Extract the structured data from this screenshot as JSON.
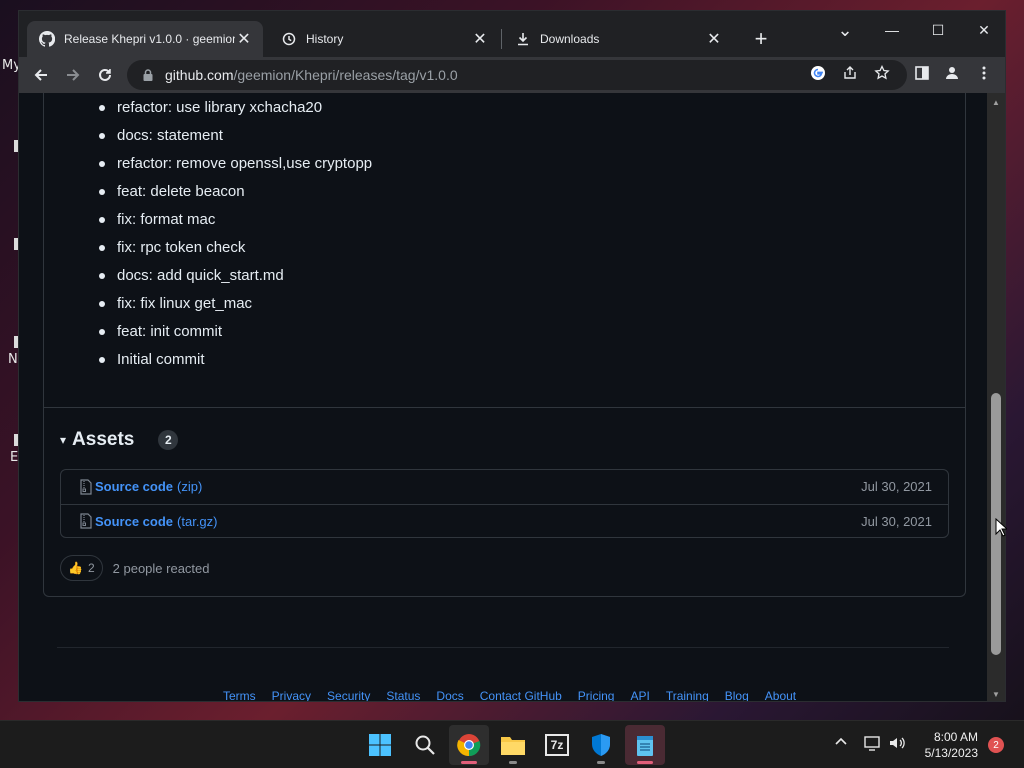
{
  "desktop": {
    "fragments": [
      "My",
      "N",
      "E"
    ]
  },
  "browser": {
    "tabs": [
      {
        "title": "Release Khepri v1.0.0 · geemion/",
        "icon": "github-icon",
        "active": true
      },
      {
        "title": "History",
        "icon": "history-icon",
        "active": false
      },
      {
        "title": "Downloads",
        "icon": "download-icon",
        "active": false
      }
    ],
    "close_glyph": "✕",
    "new_tab_glyph": "+",
    "window_controls": {
      "tab_search": "⌄",
      "minimize": "—",
      "maximize": "☐",
      "close": "✕"
    },
    "address": {
      "host": "github.com",
      "path": "/geemion/Khepri/releases/tag/v1.0.0"
    }
  },
  "release": {
    "commits": [
      "refactor: use library xchacha20",
      "docs: statement",
      "refactor: remove openssl,use cryptopp",
      "feat: delete beacon",
      "fix: format mac",
      "fix: rpc token check",
      "docs: add quick_start.md",
      "fix: fix linux get_mac",
      "feat: init commit",
      "Initial commit"
    ],
    "assets": {
      "title": "Assets",
      "count": "2",
      "toggle_glyph": "▾",
      "items": [
        {
          "name": "Source code",
          "ext": "(zip)",
          "date": "Jul 30, 2021"
        },
        {
          "name": "Source code",
          "ext": "(tar.gz)",
          "date": "Jul 30, 2021"
        }
      ]
    },
    "reactions": {
      "emoji": "👍",
      "count": "2",
      "text": "2 people reacted"
    }
  },
  "footer": {
    "links": [
      "Terms",
      "Privacy",
      "Security",
      "Status",
      "Docs",
      "Contact GitHub",
      "Pricing",
      "API",
      "Training",
      "Blog",
      "About"
    ]
  },
  "taskbar": {
    "apps": [
      "windows-start",
      "search",
      "chrome",
      "file-explorer",
      "7zip",
      "windows-security",
      "notepad"
    ],
    "sevenzip_label": "7z",
    "clock_time": "8:00 AM",
    "clock_date": "5/13/2023",
    "notification_count": "2"
  },
  "colors": {
    "page_bg": "#0d1117",
    "link": "#4493f8",
    "text": "#e6edf3",
    "muted": "#9198a1",
    "border": "#30363d"
  }
}
